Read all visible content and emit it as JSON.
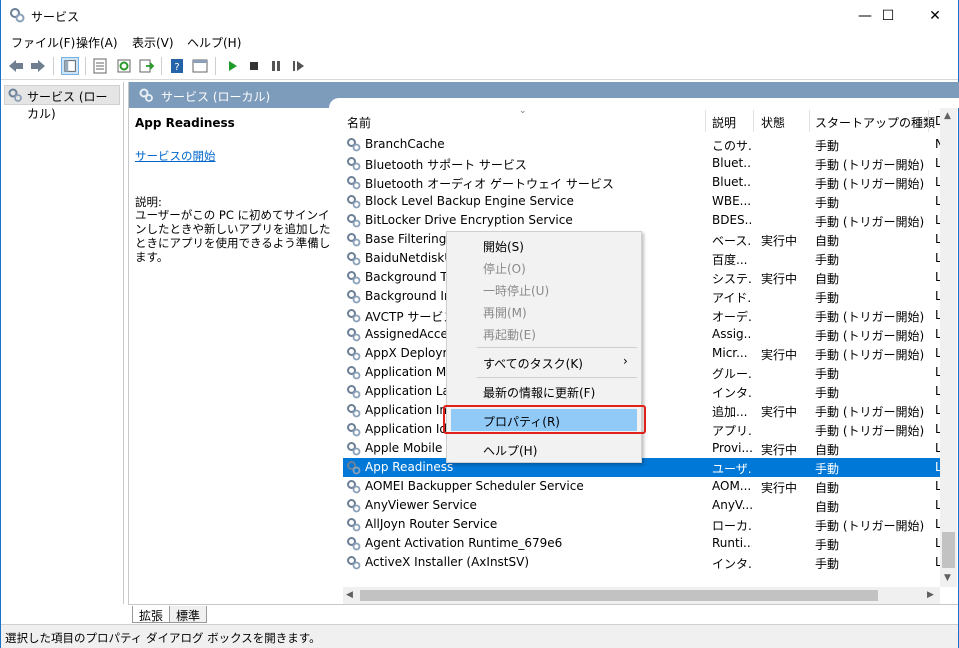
{
  "window": {
    "title": "サービス",
    "controls": {
      "minimize": "—",
      "maximize": "☐",
      "close": "✕"
    }
  },
  "menu": [
    "ファイル(F)",
    "操作(A)",
    "表示(V)",
    "ヘルプ(H)"
  ],
  "toolbar": {
    "icons": [
      "back-icon",
      "forward-icon",
      "show-hide-tree-icon",
      "properties-icon",
      "refresh-icon",
      "export-icon",
      "help-icon",
      "console-icon",
      "play-icon",
      "stop-icon",
      "pause-icon",
      "restart-icon"
    ]
  },
  "tree": {
    "root_label": "サービス (ローカル)"
  },
  "pane": {
    "header": "サービス (ローカル)",
    "selected_name": "App Readiness",
    "start_link": "サービスの開始",
    "desc_label": "説明:",
    "desc_text": "ユーザーがこの PC に初めてサインインしたときや新しいアプリを追加したときにアプリを使用できるよう準備します。"
  },
  "columns": [
    "名前",
    "説明",
    "状態",
    "スタートアップの種類",
    "D"
  ],
  "rows": [
    {
      "name": "BranchCache",
      "desc": "このサ...",
      "status": "",
      "startup": "手動",
      "logon": "N"
    },
    {
      "name": "Bluetooth サポート サービス",
      "desc": "Bluet...",
      "status": "",
      "startup": "手動 (トリガー開始)",
      "logon": "L"
    },
    {
      "name": "Bluetooth オーディオ ゲートウェイ サービス",
      "desc": "Bluet...",
      "status": "",
      "startup": "手動 (トリガー開始)",
      "logon": "L"
    },
    {
      "name": "Block Level Backup Engine Service",
      "desc": "WBE...",
      "status": "",
      "startup": "手動",
      "logon": "L"
    },
    {
      "name": "BitLocker Drive Encryption Service",
      "desc": "BDES...",
      "status": "",
      "startup": "手動 (トリガー開始)",
      "logon": "L"
    },
    {
      "name": "Base Filtering En",
      "desc": "ベース...",
      "status": "実行中",
      "startup": "自動",
      "logon": "L"
    },
    {
      "name": "BaiduNetdiskUti",
      "desc": "百度...",
      "status": "",
      "startup": "手動",
      "logon": "L"
    },
    {
      "name": "Background Tas",
      "desc": "システ...",
      "status": "実行中",
      "startup": "自動",
      "logon": "L"
    },
    {
      "name": "Background Inte",
      "desc": "アイド...",
      "status": "",
      "startup": "手動",
      "logon": "L"
    },
    {
      "name": "AVCTP サービス",
      "desc": "オーデ...",
      "status": "",
      "startup": "手動 (トリガー開始)",
      "logon": "L"
    },
    {
      "name": "AssignedAccess",
      "desc": "Assig...",
      "status": "",
      "startup": "手動 (トリガー開始)",
      "logon": "L"
    },
    {
      "name": "AppX Deployme",
      "desc": "Micr...",
      "status": "実行中",
      "startup": "手動 (トリガー開始)",
      "logon": "L"
    },
    {
      "name": "Application Mar",
      "desc": "グルー...",
      "status": "",
      "startup": "手動",
      "logon": "L"
    },
    {
      "name": "Application Laye",
      "desc": "インタ...",
      "status": "",
      "startup": "手動",
      "logon": "L"
    },
    {
      "name": "Application Info",
      "desc": "追加...",
      "status": "実行中",
      "startup": "手動 (トリガー開始)",
      "logon": "L"
    },
    {
      "name": "Application Ide",
      "desc": "アプリ...",
      "status": "",
      "startup": "手動 (トリガー開始)",
      "logon": "L"
    },
    {
      "name": "Apple Mobile De",
      "desc": "Provi...",
      "status": "実行中",
      "startup": "自動",
      "logon": "L"
    },
    {
      "name": "App Readiness",
      "desc": "ユーザ...",
      "status": "",
      "startup": "手動",
      "logon": "L",
      "selected": true
    },
    {
      "name": "AOMEI Backupper Scheduler Service",
      "desc": "AOM...",
      "status": "実行中",
      "startup": "自動",
      "logon": "L"
    },
    {
      "name": "AnyViewer Service",
      "desc": "AnyV...",
      "status": "",
      "startup": "自動",
      "logon": "L"
    },
    {
      "name": "AllJoyn Router Service",
      "desc": "ローカ...",
      "status": "",
      "startup": "手動 (トリガー開始)",
      "logon": "L"
    },
    {
      "name": "Agent Activation Runtime_679e6",
      "desc": "Runti...",
      "status": "",
      "startup": "手動",
      "logon": "L"
    },
    {
      "name": "ActiveX Installer (AxInstSV)",
      "desc": "インタ...",
      "status": "",
      "startup": "手動",
      "logon": "L"
    }
  ],
  "context_menu": {
    "start": "開始(S)",
    "stop": "停止(O)",
    "pause": "一時停止(U)",
    "resume": "再開(M)",
    "restart": "再起動(E)",
    "all_tasks": "すべてのタスク(K)",
    "refresh": "最新の情報に更新(F)",
    "properties": "プロパティ(R)",
    "help": "ヘルプ(H)"
  },
  "tabs": [
    "拡張",
    "標準"
  ],
  "status_text": "選択した項目のプロパティ ダイアログ ボックスを開きます。",
  "colors": {
    "selection": "#0078d7",
    "pane_header": "#7d9bbb",
    "menu_highlight": "#91c9f7",
    "annotation_box": "#e0201a"
  }
}
